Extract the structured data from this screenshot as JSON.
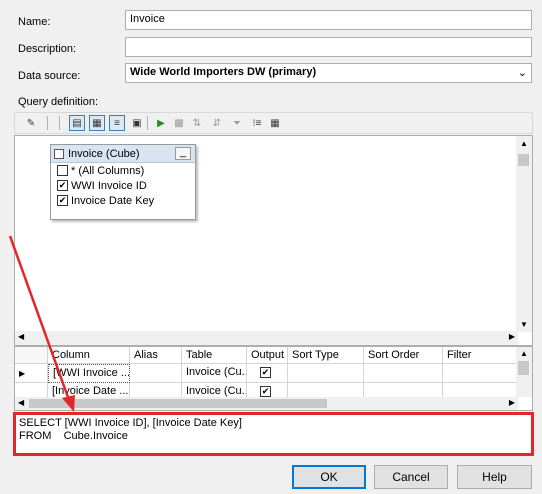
{
  "form": {
    "name_label": "Name:",
    "name_value": "Invoice",
    "description_label": "Description:",
    "description_value": "",
    "datasource_label": "Data source:",
    "datasource_value": "Wide World Importers DW (primary)",
    "query_label": "Query definition:"
  },
  "toolbar": {
    "icons": [
      "edit-as-text-icon",
      "diagram-pane-icon",
      "grid-pane-icon",
      "sql-pane-icon",
      "result-pane-icon",
      "run-icon",
      "verify-sql-icon",
      "sort-asc-icon",
      "sort-desc-icon",
      "filter-icon",
      "group-by-icon",
      "add-table-icon"
    ]
  },
  "cube": {
    "title": "Invoice (Cube)",
    "columns": [
      {
        "label": "* (All Columns)",
        "checked": false
      },
      {
        "label": "WWI Invoice ID",
        "checked": true
      },
      {
        "label": "Invoice Date Key",
        "checked": true
      }
    ]
  },
  "grid": {
    "headers": [
      "Column",
      "Alias",
      "Table",
      "Output",
      "Sort Type",
      "Sort Order",
      "Filter"
    ],
    "rows": [
      {
        "column": "[WWI Invoice ...",
        "alias": "",
        "table": "Invoice (Cu...",
        "output": true
      },
      {
        "column": "[Invoice Date ...",
        "alias": "",
        "table": "Invoice (Cu...",
        "output": true
      }
    ]
  },
  "sql": {
    "line1": "SELECT [WWI Invoice ID], [Invoice Date Key]",
    "line2": "FROM    Cube.Invoice"
  },
  "buttons": {
    "ok": "OK",
    "cancel": "Cancel",
    "help": "Help"
  },
  "colors": {
    "annotation": "#e3262a",
    "accent": "#0078d7"
  }
}
